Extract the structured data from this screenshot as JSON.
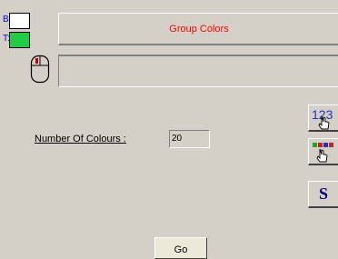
{
  "swatches": {
    "background_label": "B:",
    "text_label": "T:",
    "background_color": "#ffffff",
    "text_color": "#22cc44"
  },
  "header": {
    "title": "Group Colors",
    "title_color": "#ff0000"
  },
  "status": {
    "icon": "mouse-icon",
    "text": ""
  },
  "form": {
    "colours_label": "Number Of Colours :",
    "colours_value": "20"
  },
  "side_buttons": {
    "numbers_icon": "numbers-hand-icon",
    "numbers_text": "123",
    "palette_icon": "color-palette-hand-icon",
    "s_label": "S"
  },
  "footer": {
    "go_label": "Go"
  }
}
